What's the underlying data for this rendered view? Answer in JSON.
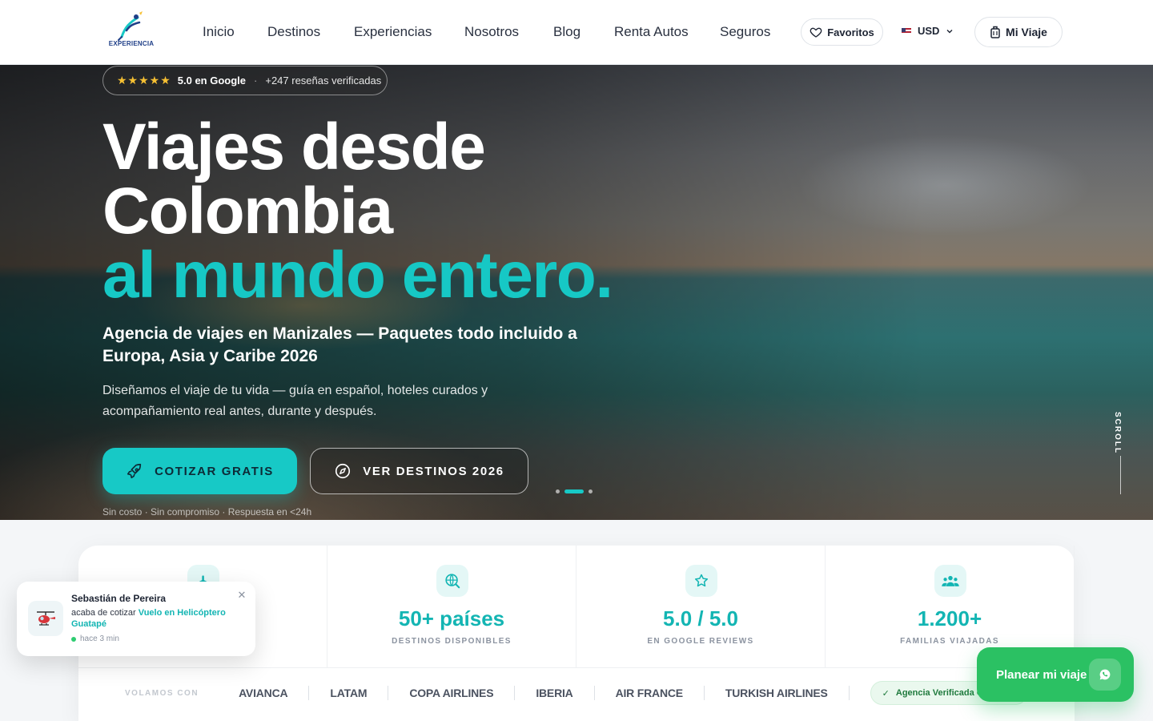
{
  "nav": {
    "logo_text": "EXPERIENCIA",
    "links": [
      "Inicio",
      "Destinos",
      "Experiencias",
      "Nosotros",
      "Blog",
      "Renta Autos",
      "Seguros"
    ],
    "favorites_label": "Favoritos",
    "currency": "USD",
    "my_trip_label": "Mi Viaje"
  },
  "hero": {
    "rating_stars": "★★★★★",
    "rating_value": "5.0 en Google",
    "rating_separator": "·",
    "rating_reviews": "+247 reseñas verificadas",
    "title_line1": "Viajes desde",
    "title_line2": "Colombia",
    "title_line3": "al mundo entero.",
    "subtitle": "Agencia de viajes en Manizales — Paquetes todo incluido a Europa, Asia y Caribe 2026",
    "description": "Diseñamos el viaje de tu vida — guía en español, hoteles curados y acompañamiento real antes, durante y después.",
    "cta_primary": "COTIZAR GRATIS",
    "cta_secondary": "VER DESTINOS 2026",
    "note": "Sin costo · Sin compromiso · Respuesta en <24h",
    "scroll_label": "SCROLL",
    "slides_total": 3,
    "slide_active": 2
  },
  "stats": [
    {
      "icon": "plane-icon",
      "value": "",
      "label": ""
    },
    {
      "icon": "globe-search-icon",
      "value": "50+ países",
      "label": "DESTINOS DISPONIBLES"
    },
    {
      "icon": "star-icon",
      "value": "5.0 / 5.0",
      "label": "EN GOOGLE REVIEWS"
    },
    {
      "icon": "users-icon",
      "value": "1.200+",
      "label": "FAMILIAS VIAJADAS"
    }
  ],
  "airlines": {
    "label": "VOLAMOS CON",
    "items": [
      "AVIANCA",
      "LATAM",
      "COPA AIRLINES",
      "IBERIA",
      "AIR FRANCE",
      "TURKISH AIRLINES"
    ],
    "verified_badge": "Agencia Verificada Google E"
  },
  "toast": {
    "name": "Sebastián de Pereira",
    "message_prefix": "acaba de cotizar",
    "message_highlight": "Vuelo en Helicóptero Guatapé",
    "time": "hace 3 min"
  },
  "fab": {
    "label": "Planear mi viaje"
  },
  "colors": {
    "accent": "#17c9c6",
    "accent_dark": "#13b5b3",
    "whatsapp": "#2bc163",
    "star": "#f6c033"
  }
}
